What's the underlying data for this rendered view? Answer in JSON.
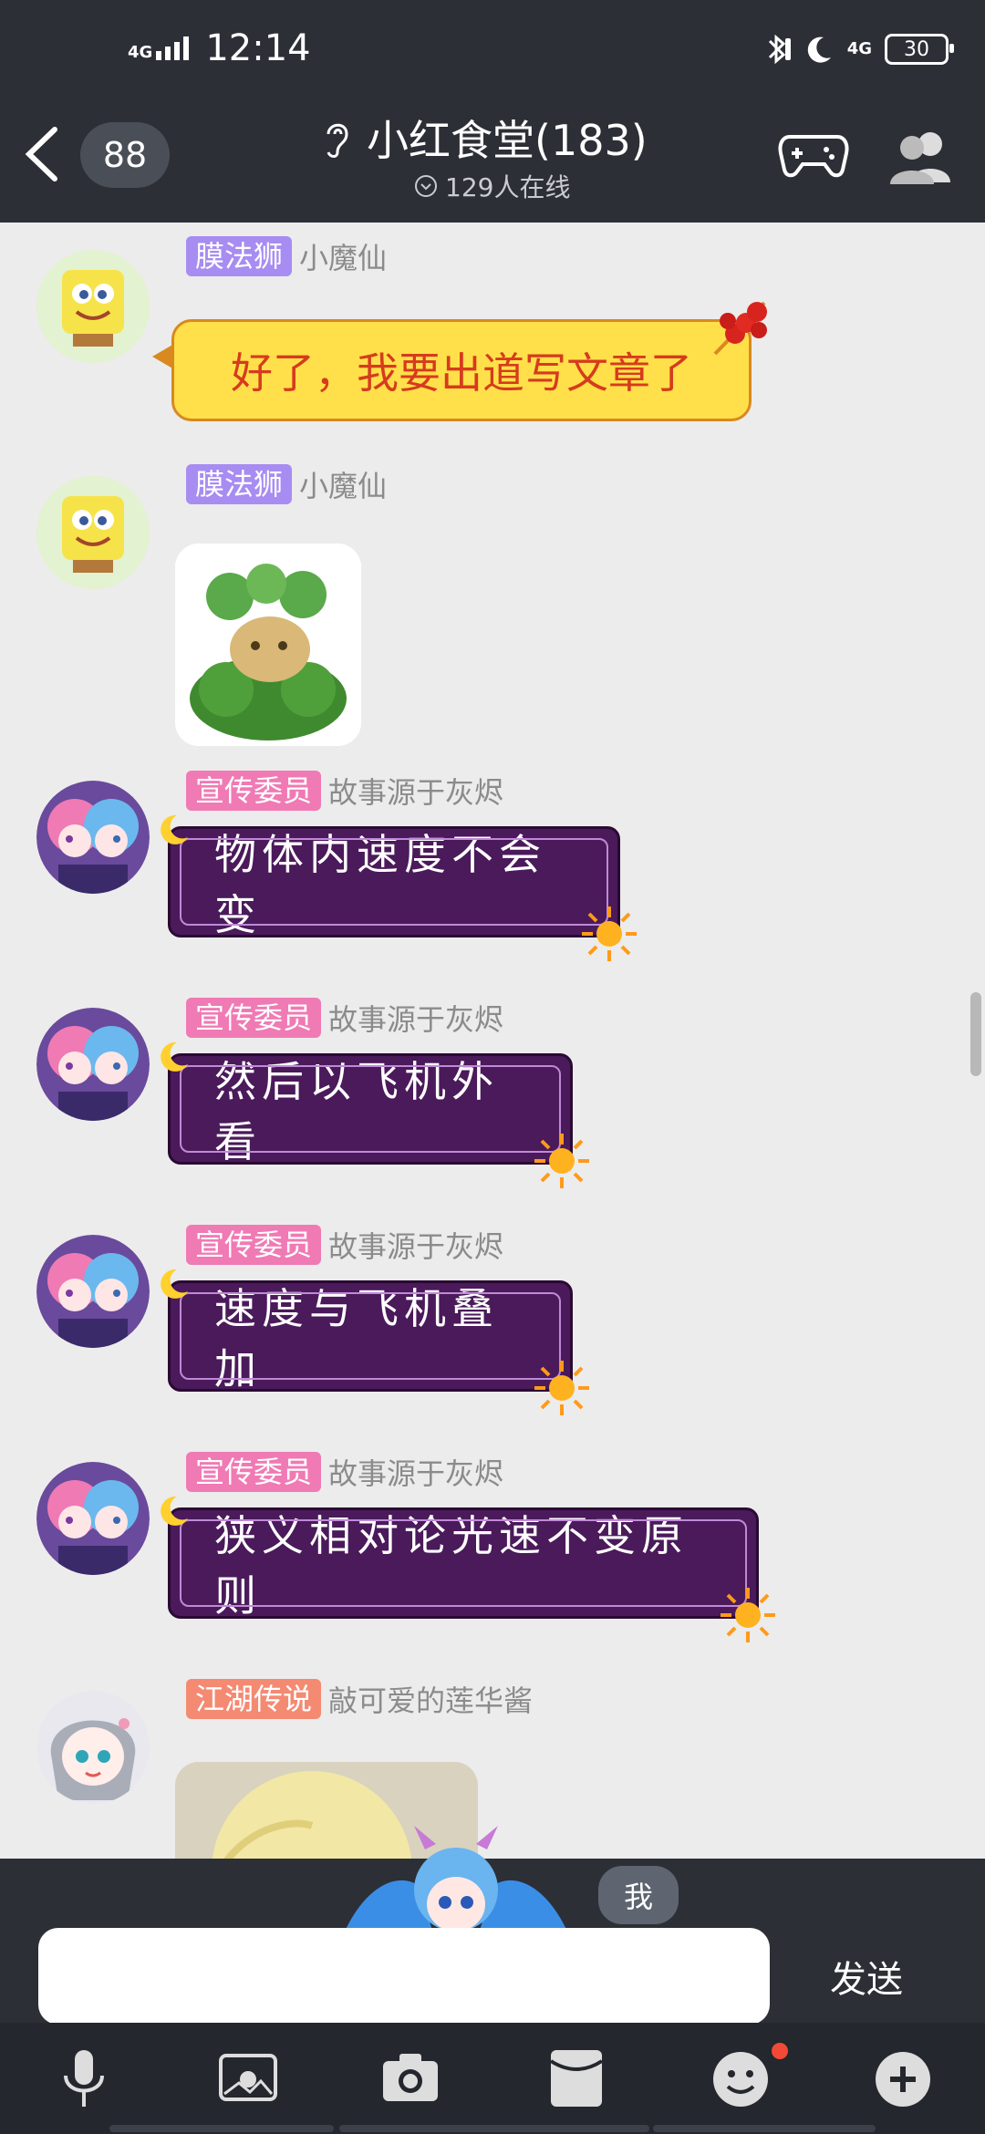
{
  "status_bar": {
    "network": "4G",
    "time": "12:14",
    "network_right": "4G",
    "battery": "30"
  },
  "header": {
    "unread_count": "88",
    "group_name": "小红食堂(183)",
    "online_text": "129人在线"
  },
  "messages": [
    {
      "badge": "膜法狮",
      "nickname": "小魔仙",
      "text": "好了，我要出道写文章了"
    },
    {
      "badge": "膜法狮",
      "nickname": "小魔仙"
    },
    {
      "badge": "宣传委员",
      "nickname": "故事源于灰烬",
      "text": "物体内速度不会变"
    },
    {
      "badge": "宣传委员",
      "nickname": "故事源于灰烬",
      "text": "然后以飞机外看"
    },
    {
      "badge": "宣传委员",
      "nickname": "故事源于灰烬",
      "text": "速度与飞机叠加"
    },
    {
      "badge": "宣传委员",
      "nickname": "故事源于灰烬",
      "text": "狭义相对论光速不变原则"
    },
    {
      "badge": "江湖传说",
      "nickname": "敲可爱的莲华酱"
    }
  ],
  "input": {
    "me_label": "我",
    "value": "",
    "send_label": "发送"
  },
  "colors": {
    "header_bg": "#2c2f36",
    "chat_bg": "#ececec",
    "badge_purple": "#a78cf2",
    "badge_pink": "#f07ab4",
    "badge_orange": "#f48a72",
    "purple_bubble": "#4a1a5a",
    "yellow_bubble": "#ffe04a"
  },
  "toolbar_icons": [
    "microphone-icon",
    "photo-album-icon",
    "camera-icon",
    "red-packet-icon",
    "emoji-icon",
    "plus-icon"
  ]
}
